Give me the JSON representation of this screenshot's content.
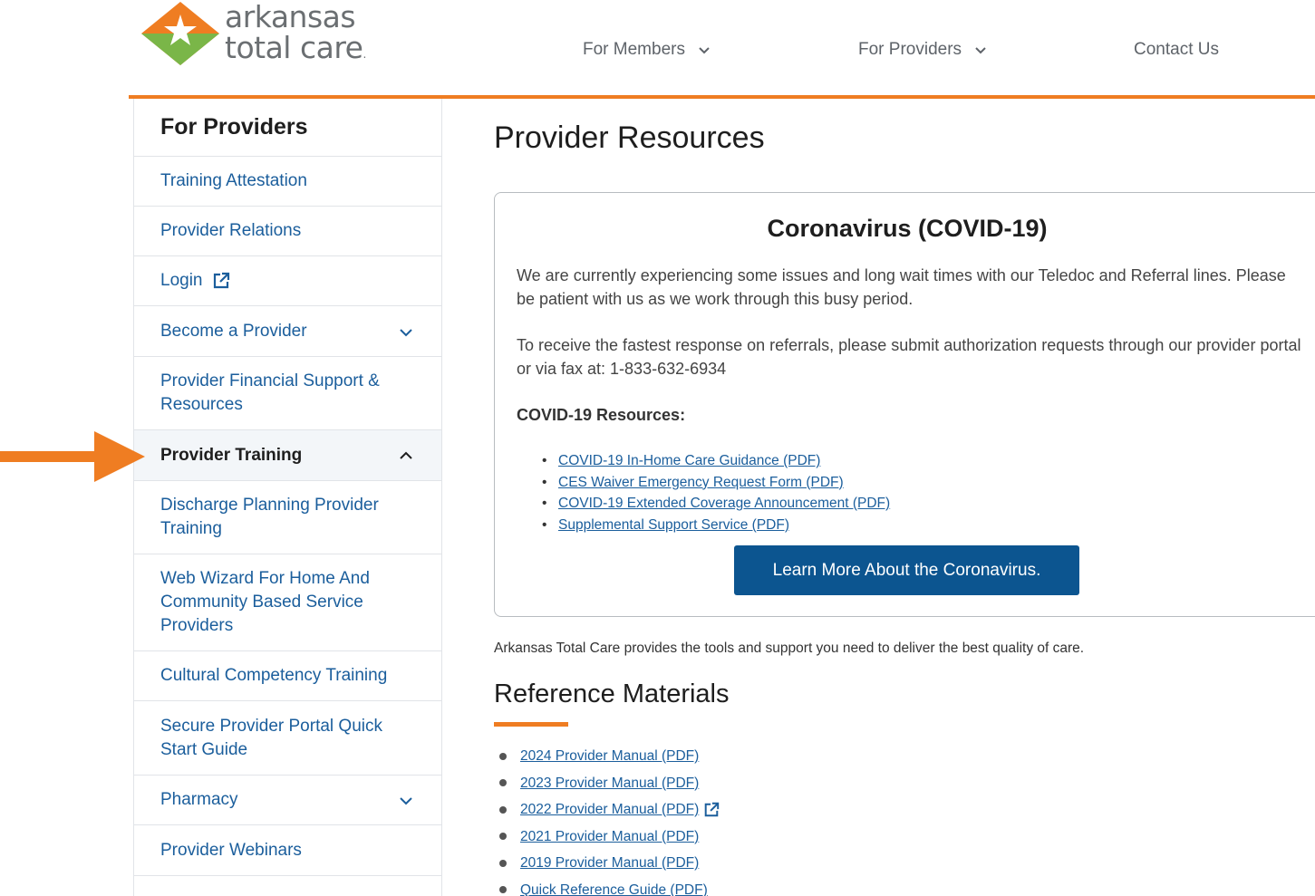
{
  "brand": {
    "line1": "arkansas",
    "line2": "total care",
    "colors": {
      "orange": "#ef7d22",
      "green": "#7ab648",
      "blue": "#1b5e9c",
      "button": "#0c5590"
    }
  },
  "nav": {
    "members": "For Members",
    "providers": "For Providers",
    "contact": "Contact Us"
  },
  "sidebar": {
    "heading": "For Providers",
    "items": [
      {
        "label": "Training Attestation"
      },
      {
        "label": "Provider Relations"
      },
      {
        "label": "Login",
        "icon": "external-link-icon"
      },
      {
        "label": "Become a Provider",
        "icon": "chevron-down-icon"
      },
      {
        "label": "Provider Financial Support & Resources"
      },
      {
        "label": "Provider Training",
        "icon": "chevron-up-icon",
        "active": true
      },
      {
        "label": "Discharge Planning Provider Training"
      },
      {
        "label": "Web Wizard For Home And Community Based Service Providers"
      },
      {
        "label": "Cultural Competency Training"
      },
      {
        "label": "Secure Provider Portal Quick Start Guide"
      },
      {
        "label": "Pharmacy",
        "icon": "chevron-down-icon"
      },
      {
        "label": "Provider Webinars"
      }
    ]
  },
  "main": {
    "title": "Provider Resources",
    "covid": {
      "title": "Coronavirus (COVID-19)",
      "p1": "We are currently experiencing some issues and long wait times with our Teledoc and Referral lines. Please be patient with us as we work through this busy period.",
      "p2": "To receive the fastest response on referrals, please submit authorization requests through our provider portal or via fax at: 1-833-632-6934",
      "resources_heading": "COVID-19 Resources:",
      "links": [
        "COVID-19 In-Home Care Guidance (PDF)",
        "CES Waiver Emergency Request Form (PDF)",
        "COVID-19 Extended Coverage Announcement (PDF)",
        "Supplemental Support Service (PDF)"
      ],
      "button": "Learn More About the Coronavirus."
    },
    "intro": "Arkansas Total Care provides the tools and support you need to deliver the best quality of care.",
    "reference": {
      "title": "Reference Materials",
      "links": [
        "2024 Provider Manual (PDF)",
        "2023 Provider Manual (PDF)",
        "2022 Provider Manual (PDF)",
        "2021 Provider Manual (PDF)",
        "2019 Provider Manual (PDF)",
        "Quick Reference Guide (PDF)"
      ]
    }
  }
}
